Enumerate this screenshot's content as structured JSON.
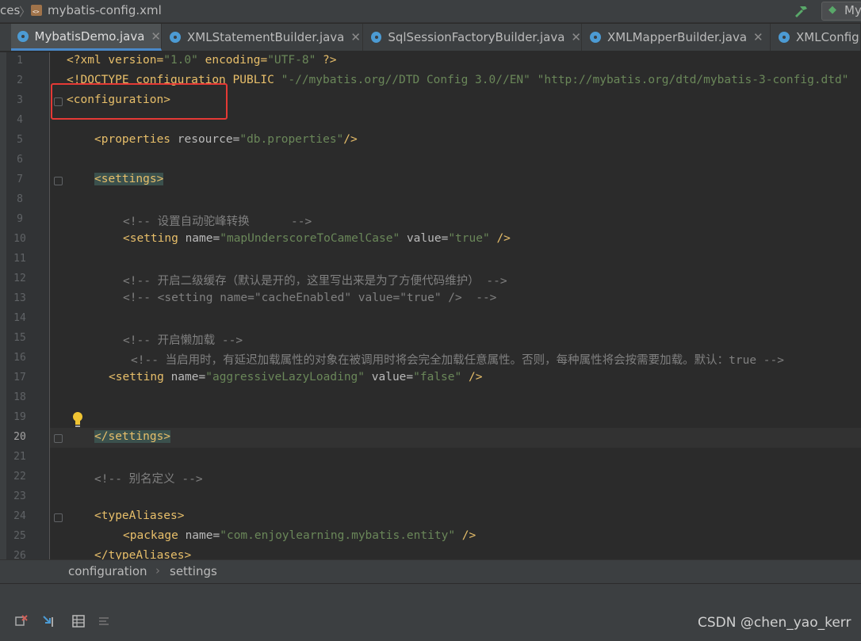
{
  "breadcrumb": {
    "prefix": "ces",
    "file": "mybatis-config.xml",
    "right_label": "My"
  },
  "tabs": [
    {
      "label": "MybatisDemo.java",
      "close": "✕"
    },
    {
      "label": "XMLStatementBuilder.java",
      "close": "✕"
    },
    {
      "label": "SqlSessionFactoryBuilder.java",
      "close": "✕"
    },
    {
      "label": "XMLMapperBuilder.java",
      "close": "✕"
    },
    {
      "label": "XMLConfig",
      "close": ""
    }
  ],
  "line_numbers": [
    "1",
    "2",
    "3",
    "4",
    "5",
    "6",
    "7",
    "8",
    "9",
    "10",
    "11",
    "12",
    "13",
    "14",
    "15",
    "16",
    "17",
    "18",
    "19",
    "20",
    "21",
    "22",
    "23",
    "24",
    "25",
    "26"
  ],
  "current_line": "20",
  "code": {
    "l1": {
      "a": "<?xml version=",
      "b": "\"1.0\"",
      "c": " encoding=",
      "d": "\"UTF-8\"",
      "e": " ?>"
    },
    "l2": {
      "a": "<!DOCTYPE configuration PUBLIC ",
      "b": "\"-//mybatis.org//DTD Config 3.0//EN\"",
      "c": " ",
      "d": "\"http://mybatis.org/dtd/mybatis-3-config.dtd\""
    },
    "l3": "<configuration>",
    "l5": {
      "a": "<properties",
      "b": " resource=",
      "c": "\"db.properties\"",
      "d": "/>"
    },
    "l7": "<settings>",
    "l9": "<!-- 设置自动驼峰转换      -->",
    "l10": {
      "a": "<setting",
      "b": " name=",
      "c": "\"mapUnderscoreToCamelCase\"",
      "d": " value=",
      "e": "\"true\"",
      "f": " />"
    },
    "l12": "<!-- 开启二级缓存（默认是开的，这里写出来是为了方便代码维护） -->",
    "l13": "<!-- <setting name=\"cacheEnabled\" value=\"true\" />  -->",
    "l15": "<!-- 开启懒加载 -->",
    "l16": "<!-- 当启用时，有延迟加载属性的对象在被调用时将会完全加载任意属性。否则，每种属性将会按需要加载。默认：true -->",
    "l17": {
      "a": "<setting",
      "b": " name=",
      "c": "\"aggressiveLazyLoading\"",
      "d": " value=",
      "e": "\"false\"",
      "f": " />"
    },
    "l20": "</settings>",
    "l22": "<!-- 别名定义 -->",
    "l24": "<typeAliases>",
    "l25": {
      "a": "<package",
      "b": " name=",
      "c": "\"com.enjoylearning.mybatis.entity\"",
      "d": " />"
    },
    "l26": "</typeAliases>"
  },
  "status": {
    "crumb1": "configuration",
    "sep": "›",
    "crumb2": "settings"
  },
  "watermark": "CSDN @chen_yao_kerr"
}
